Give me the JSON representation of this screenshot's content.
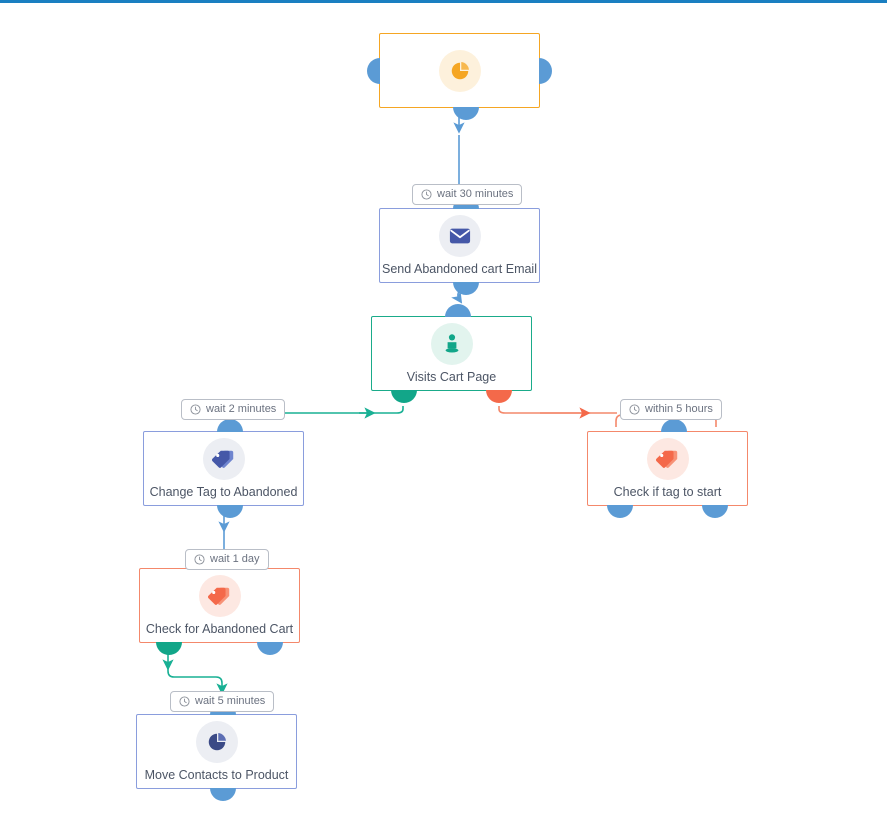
{
  "canvas": {
    "background_color": "#ffffff",
    "top_rule_color": "#1a7fc1"
  },
  "palette": {
    "orange": "#f5a623",
    "blue": "#5b9bd5",
    "node_blue_border": "#8a9ddd",
    "green": "#12a689",
    "red": "#f4694a",
    "red_border": "#f4886b",
    "label_text": "#4c5565",
    "pill_text": "#6b7280"
  },
  "nodes": [
    {
      "id": "trigger",
      "label": "",
      "icon": "pie-chart-icon",
      "accent": "orange"
    },
    {
      "id": "send-email",
      "label": "Send Abandoned cart Email",
      "icon": "envelope-icon",
      "accent": "blue"
    },
    {
      "id": "visits-cart-page",
      "label": "Visits Cart Page",
      "icon": "person-icon",
      "accent": "green"
    },
    {
      "id": "change-tag",
      "label": "Change Tag to Abandoned",
      "icon": "tag-icon",
      "accent": "blue"
    },
    {
      "id": "check-tag-start",
      "label": "Check if tag to start",
      "icon": "tag-icon",
      "accent": "red"
    },
    {
      "id": "check-abandoned-cart",
      "label": "Check for Abandoned Cart",
      "icon": "tag-icon",
      "accent": "red"
    },
    {
      "id": "move-contacts",
      "label": "Move Contacts to Product",
      "icon": "pie-chart-icon",
      "accent": "blue"
    }
  ],
  "edge_labels": [
    {
      "id": "wait-30-minutes",
      "text": "wait 30 minutes",
      "icon": "clock-icon"
    },
    {
      "id": "wait-2-minutes",
      "text": "wait 2 minutes",
      "icon": "clock-icon"
    },
    {
      "id": "within-5-hours",
      "text": "within 5 hours",
      "icon": "clock-icon"
    },
    {
      "id": "wait-1-day",
      "text": "wait 1 day",
      "icon": "clock-icon"
    },
    {
      "id": "wait-5-minutes",
      "text": "wait 5 minutes",
      "icon": "clock-icon"
    }
  ]
}
